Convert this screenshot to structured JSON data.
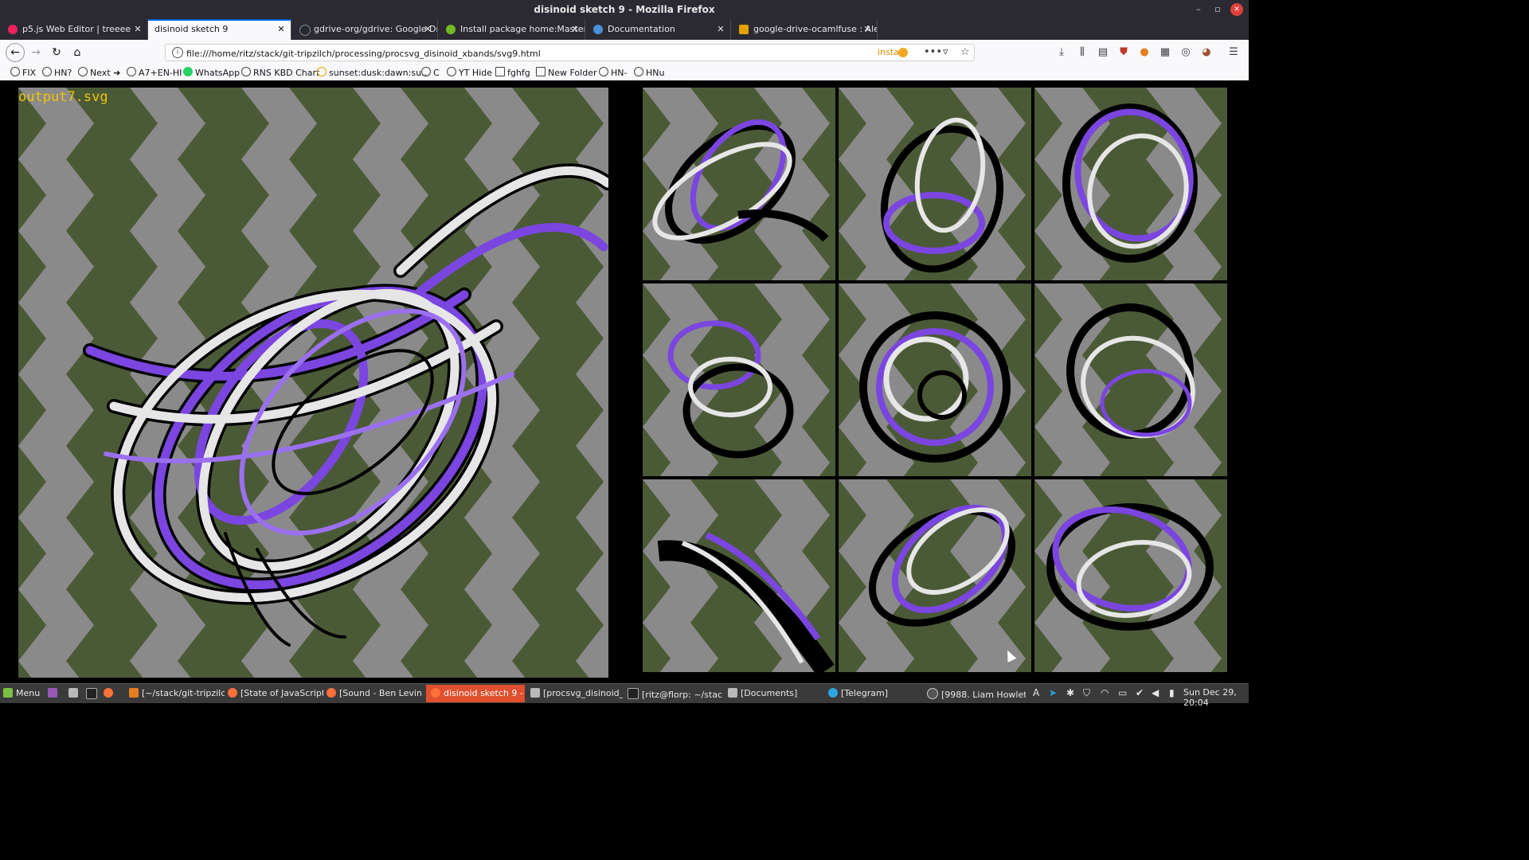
{
  "window": {
    "title": "disinoid sketch 9 - Mozilla Firefox"
  },
  "tabs": [
    {
      "label": "p5.js Web Editor | treeee",
      "color": "#ed225d"
    },
    {
      "label": "disinoid sketch 9",
      "color": ""
    },
    {
      "label": "gdrive-org/gdrive: Google Dr",
      "color": "#24292e"
    },
    {
      "label": "Install package home:Master",
      "color": "#73ba25"
    },
    {
      "label": "Documentation",
      "color": "#4a90d9"
    },
    {
      "label": "google-drive-ocamlfuse : Ale",
      "color": "#e5a000"
    }
  ],
  "urlbar": {
    "url": "file:///home/ritz/stack/git-tripzilch/processing/procsvg_disinoid_xbands/svg9.html",
    "extension_label": "insta"
  },
  "bookmarks": [
    "FIX",
    "HN?",
    "Next ➜",
    "A7+EN-HI",
    "WhatsApp",
    "RNS KBD Chart",
    "sunset:dusk:dawn:su...",
    "C",
    "YT Hide",
    "fghfg",
    "New Folder",
    "HN-",
    "HNu"
  ],
  "canvas": {
    "label": "output7.svg"
  },
  "taskbar": {
    "menu_label": "Menu",
    "windows": [
      "[~/stack/git-tripzilch...",
      "[State of JavaScript ...",
      "[Sound - Ben Levin - ...",
      "disinoid sketch 9 - ...",
      "[procsvg_disinoid_x...",
      "[ritz@florp: ~/stack/...",
      "[Documents]",
      "[Telegram]",
      "[9988. Liam Howlett..."
    ],
    "clock": "Sun Dec 29, 20:04"
  },
  "colors": {
    "accent": "#0060df",
    "purple": "#7b45e0",
    "olive": "#4b5a36",
    "gray": "#8a8a8a"
  }
}
